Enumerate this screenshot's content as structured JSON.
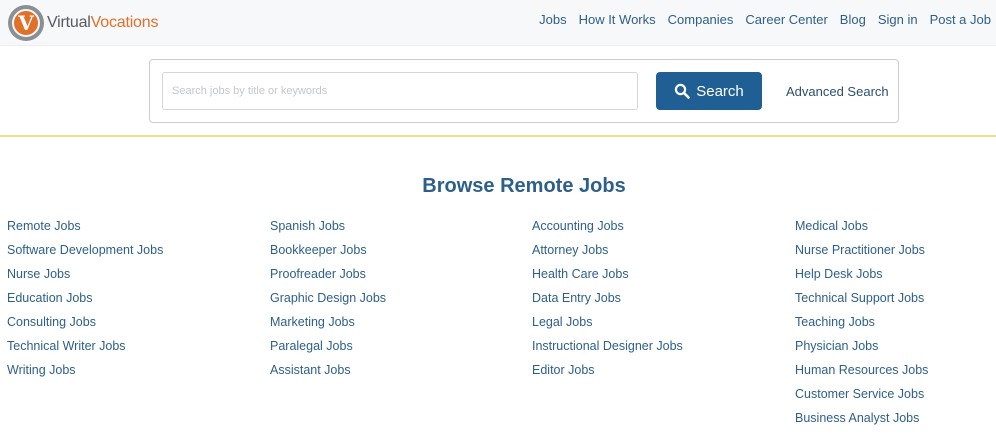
{
  "brand": {
    "logo_letter": "V",
    "name_part1": "Virtual",
    "name_part2": "Vocations",
    "colors": {
      "accent": "#e0702a",
      "link": "#2d5f8b",
      "button": "#1f5f94",
      "divider": "#f0dc8a"
    }
  },
  "nav": {
    "items": [
      {
        "label": "Jobs"
      },
      {
        "label": "How It Works"
      },
      {
        "label": "Companies"
      },
      {
        "label": "Career Center"
      },
      {
        "label": "Blog"
      },
      {
        "label": "Sign in"
      },
      {
        "label": "Post a Job"
      }
    ]
  },
  "search": {
    "placeholder": "Search jobs by title or keywords",
    "value": "",
    "button_label": "Search",
    "button_icon": "search-icon",
    "advanced_label": "Advanced Search"
  },
  "browse": {
    "title": "Browse Remote Jobs",
    "columns": [
      [
        "Remote Jobs",
        "Software Development Jobs",
        "Nurse Jobs",
        "Education Jobs",
        "Consulting Jobs",
        "Technical Writer Jobs",
        "Writing Jobs"
      ],
      [
        "Spanish Jobs",
        "Bookkeeper Jobs",
        "Proofreader Jobs",
        "Graphic Design Jobs",
        "Marketing Jobs",
        "Paralegal Jobs",
        "Assistant Jobs"
      ],
      [
        "Accounting Jobs",
        "Attorney Jobs",
        "Health Care Jobs",
        "Data Entry Jobs",
        "Legal Jobs",
        "Instructional Designer Jobs",
        "Editor Jobs"
      ],
      [
        "Medical Jobs",
        "Nurse Practitioner Jobs",
        "Help Desk Jobs",
        "Technical Support Jobs",
        "Teaching Jobs",
        "Physician Jobs",
        "Human Resources Jobs",
        "Customer Service Jobs",
        "Business Analyst Jobs"
      ]
    ]
  }
}
